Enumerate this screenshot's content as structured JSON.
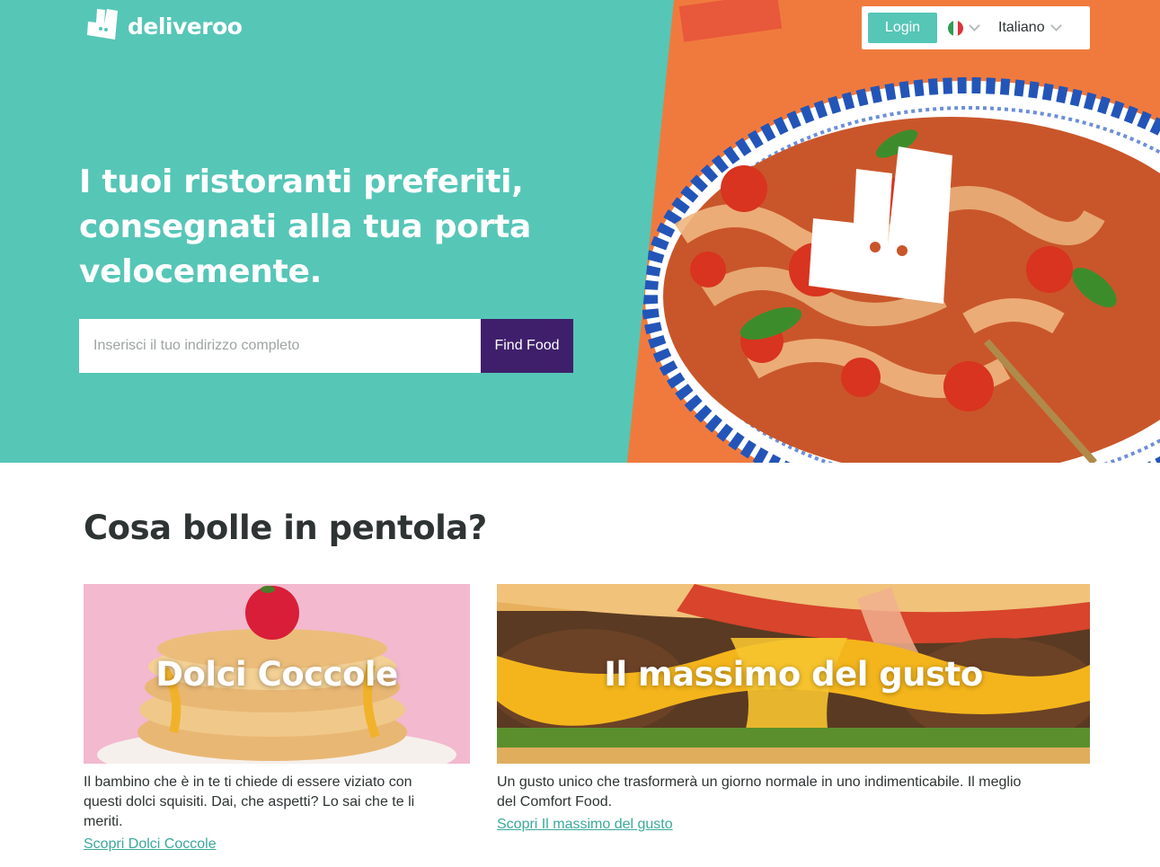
{
  "brand": {
    "name": "deliveroo",
    "accent": "#56c6b7",
    "dark": "#3f1f6b"
  },
  "header": {
    "login_label": "Login",
    "country_flag": "italy-flag-icon",
    "language_label": "Italiano"
  },
  "hero": {
    "headline": "I tuoi ristoranti preferiti, consegnati alla tua porta velocemente.",
    "search_placeholder": "Inserisci il tuo indirizzo completo",
    "search_value": "",
    "button_label": "Find Food"
  },
  "section": {
    "title": "Cosa bolle in pentola?",
    "cards": [
      {
        "title": "Dolci Coccole",
        "description": "Il bambino che è in te ti chiede di essere viziato con questi dolci squisiti. Dai, che aspetti? Lo sai che te li meriti.",
        "link": "Scopri Dolci Coccole"
      },
      {
        "title": "Il massimo del gusto",
        "description": "Un gusto unico che trasformerà un giorno normale in uno indimenticabile. Il meglio del Comfort Food.",
        "link": "Scopri Il massimo del gusto"
      }
    ]
  }
}
